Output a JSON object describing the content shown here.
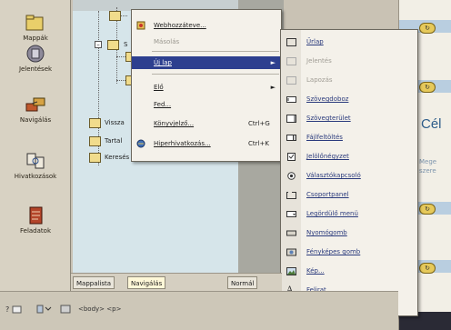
{
  "nav_pane": {
    "items": [
      {
        "label": "Mappák",
        "icon": "folders-icon"
      },
      {
        "label": "Jelentések",
        "icon": "reports-icon"
      },
      {
        "label": "Navigálás",
        "icon": "navigation-icon"
      },
      {
        "label": "Hivatkozások",
        "icon": "hyperlinks-icon"
      },
      {
        "label": "Feladatok",
        "icon": "tasks-icon"
      }
    ]
  },
  "tree": {
    "folders": [
      {
        "label": "Vissza"
      },
      {
        "label": "Tartal"
      },
      {
        "label": "Keresés"
      }
    ]
  },
  "context_menu": {
    "items": [
      {
        "label": "Webhozzáteve...",
        "shortcut": "",
        "disabled": false,
        "submenu": false,
        "highlight": false
      },
      {
        "label": "Másolás",
        "shortcut": "",
        "disabled": true,
        "submenu": false,
        "highlight": false
      },
      {
        "label": "Új lap",
        "shortcut": "",
        "disabled": false,
        "submenu": true,
        "highlight": true
      },
      {
        "label": "Elő",
        "shortcut": "",
        "disabled": false,
        "submenu": true,
        "highlight": false
      },
      {
        "label": "Fed...",
        "shortcut": "",
        "disabled": false,
        "submenu": false,
        "highlight": false
      },
      {
        "label": "Könyvjelző...",
        "shortcut": "Ctrl+G",
        "disabled": false,
        "submenu": false,
        "highlight": false
      },
      {
        "label": "Hiperhivatkozás...",
        "shortcut": "Ctrl+K",
        "disabled": false,
        "submenu": false,
        "highlight": false
      }
    ],
    "submenu_arrow": "►"
  },
  "submenu": {
    "items": [
      {
        "label": "Űrlap",
        "disabled": false,
        "icon": "form-icon"
      },
      {
        "label": "Jelentés",
        "disabled": true,
        "icon": "report-icon"
      },
      {
        "label": "Lapozás",
        "disabled": true,
        "icon": "paging-icon"
      },
      {
        "label": "Szövegdoboz",
        "disabled": false,
        "icon": "textbox-icon"
      },
      {
        "label": "Szövegterület",
        "disabled": false,
        "icon": "textarea-icon"
      },
      {
        "label": "Fájlfeltöltés",
        "disabled": false,
        "icon": "file-upload-icon"
      },
      {
        "label": "Jelölőnégyzet",
        "disabled": false,
        "icon": "checkbox-icon"
      },
      {
        "label": "Választókapcsoló",
        "disabled": false,
        "icon": "radio-button-icon"
      },
      {
        "label": "Csoportpanel",
        "disabled": false,
        "icon": "group-box-icon"
      },
      {
        "label": "Legördülő menü",
        "disabled": false,
        "icon": "dropdown-icon"
      },
      {
        "label": "Nyomógomb",
        "disabled": false,
        "icon": "push-button-icon"
      },
      {
        "label": "Fényképes gomb",
        "disabled": false,
        "icon": "picture-button-icon"
      },
      {
        "label": "Kép...",
        "disabled": false,
        "icon": "image-icon"
      },
      {
        "label": "Felirat",
        "disabled": false,
        "icon": "label-icon"
      }
    ]
  },
  "doc_pane": {
    "heading": "Cél",
    "small_lines": [
      "Mege",
      "szere"
    ],
    "bullet_glyph": "↻"
  },
  "pane_tabs": {
    "folders_tab": "Mappalista",
    "navigation_tab": "Navigálás",
    "normal_tab": "Normál"
  },
  "status_bar": {
    "tags": "<body> <p>"
  },
  "colors": {
    "menu_highlight": "#2d3f8f",
    "submenu_text": "#2a3a7c",
    "doc_heading": "#2e5d8a",
    "tree_background": "#d6e5ea"
  }
}
